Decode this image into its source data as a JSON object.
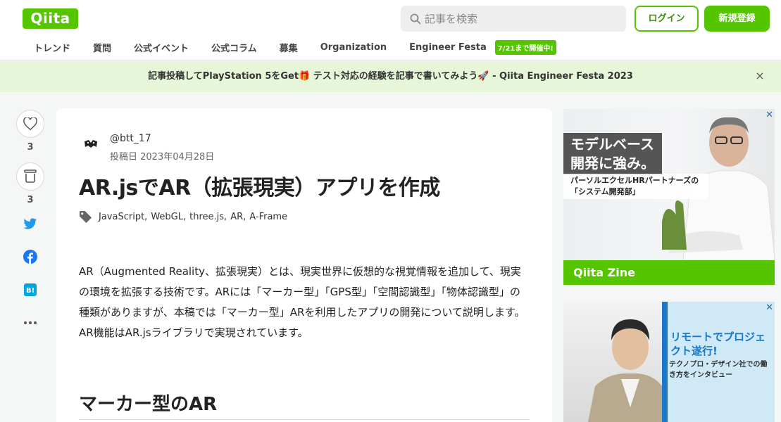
{
  "header": {
    "logo": "Qiita",
    "search_placeholder": "記事を検索",
    "login_label": "ログイン",
    "signup_label": "新規登録",
    "brand_color": "#55c500"
  },
  "nav": {
    "items": [
      "トレンド",
      "質問",
      "公式イベント",
      "公式コラム",
      "募集",
      "Organization",
      "Engineer Festa"
    ],
    "badge": "7/21まで開催中!"
  },
  "banner": {
    "text": "記事投稿してPlayStation 5をGet🎁 テスト対応の経験を記事で書いてみよう🚀 - Qiita Engineer Festa 2023",
    "close": "×"
  },
  "rail": {
    "like_count": "3",
    "stock_count": "3",
    "icons": [
      "heart-icon",
      "stock-icon",
      "twitter-icon",
      "facebook-icon",
      "hatena-bookmark-icon",
      "more-icon"
    ]
  },
  "article": {
    "author": "@btt_17",
    "posted": "投稿日 2023年04月28日",
    "title": "AR.jsでAR（拡張現実）アプリを作成",
    "tags": [
      "JavaScript",
      "WebGL",
      "three.js",
      "AR",
      "A-Frame"
    ],
    "tag_separator": ",",
    "body": "AR（Augmented Reality、拡張現実）とは、現実世界に仮想的な視覚情報を追加して、現実の環境を拡張する技術です。ARには「マーカー型」「GPS型」「空間認識型」「物体認識型」の種類がありますが、本稿では「マーカー型」ARを利用したアプリの開発について説明します。AR機能はAR.jsライブラリで実現されています。",
    "heading": "マーカー型のAR"
  },
  "ads": {
    "ad1": {
      "title": "モデルベース開発に強み。",
      "subtitle": "パーソルエクセルHRパートナーズの「システム開発部」",
      "footer": "Qiita Zine",
      "close": "✕"
    },
    "ad2": {
      "title": "リモートでプロジェクト遂行!",
      "subtitle": "テクノプロ・デザイン社での働き方をインタビュー",
      "close": "✕"
    }
  }
}
